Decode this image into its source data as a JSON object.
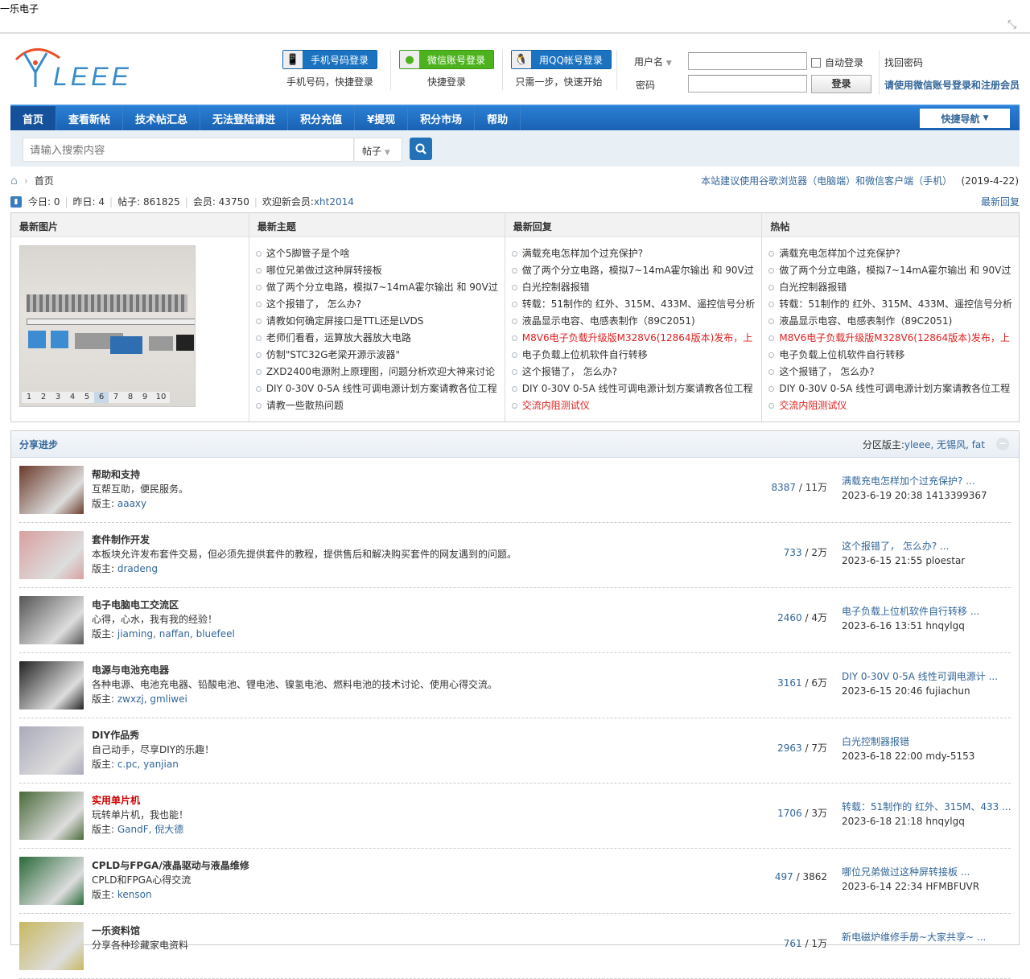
{
  "window": {
    "title": "一乐电子"
  },
  "header": {
    "logo_text": "YLEEE",
    "phone_login": "手机号码登录",
    "phone_sub": "手机号码，快捷登录",
    "wechat_login": "微信账号登录",
    "wechat_sub": "快捷登录",
    "qq_login": "用QQ帐号登录",
    "qq_sub": "只需一步，快速开始",
    "username_label": "用户名",
    "password_label": "密码",
    "username_value": "",
    "password_value": "",
    "auto_login": "自动登录",
    "login_button": "登录",
    "forgot": "找回密码",
    "register_hint": "请使用微信账号登录和注册会员"
  },
  "nav": {
    "items": [
      "首页",
      "查看新帖",
      "技术帖汇总",
      "无法登陆请进",
      "积分充值",
      "¥提现",
      "积分市场",
      "帮助"
    ],
    "quick_nav": "快捷导航"
  },
  "search": {
    "placeholder": "请输入搜索内容",
    "type": "帖子"
  },
  "breadcrumb": {
    "home": "首页",
    "notice": "本站建议使用谷歌浏览器（电脑端）和微信客户端（手机）",
    "date": "(2019-4-22)"
  },
  "stats": {
    "today": "今日: 0",
    "yesterday": "昨日: 4",
    "posts": "帖子: 861825",
    "members": "会员: 43750",
    "welcome": "欢迎新会员: ",
    "new_member": "xht2014",
    "latest_reply": "最新回复"
  },
  "columns": {
    "pics": {
      "title": "最新图片",
      "pages": [
        "1",
        "2",
        "3",
        "4",
        "5",
        "6",
        "7",
        "8",
        "9",
        "10"
      ],
      "active_page": "6"
    },
    "lists": [
      {
        "title": "最新主题",
        "items": [
          {
            "t": "这个5脚管子是个啥"
          },
          {
            "t": "哪位兄弟做过这种屏转接板"
          },
          {
            "t": "做了两个分立电路，模拟7~14mA霍尔输出 和 90V过"
          },
          {
            "t": "这个报错了， 怎么办?"
          },
          {
            "t": "请教如何确定屏接口是TTL还是LVDS"
          },
          {
            "t": "老师们看看，运算放大器放大电路"
          },
          {
            "t": "仿制\"STC32G老梁开源示波器\""
          },
          {
            "t": "ZXD2400电源附上原理图，问题分析欢迎大神来讨论"
          },
          {
            "t": "DIY 0-30V 0-5A 线性可调电源计划方案请教各位工程"
          },
          {
            "t": "请教一些散热问题"
          }
        ]
      },
      {
        "title": "最新回复",
        "items": [
          {
            "t": "满载充电怎样加个过充保护?"
          },
          {
            "t": "做了两个分立电路，模拟7~14mA霍尔输出 和 90V过"
          },
          {
            "t": "白光控制器报错"
          },
          {
            "t": "转载：51制作的 红外、315M、433M、遥控信号分析"
          },
          {
            "t": "液晶显示电容、电感表制作（89C2051)"
          },
          {
            "t": "M8V6电子负载升级版M328V6(12864版本)发布，上",
            "red": true
          },
          {
            "t": "电子负载上位机软件自行转移"
          },
          {
            "t": "这个报错了， 怎么办?"
          },
          {
            "t": "DIY 0-30V 0-5A 线性可调电源计划方案请教各位工程"
          },
          {
            "t": "交流内阻测试仪",
            "red": true
          }
        ]
      },
      {
        "title": "热帖",
        "items": [
          {
            "t": "满载充电怎样加个过充保护?"
          },
          {
            "t": "做了两个分立电路，模拟7~14mA霍尔输出 和 90V过"
          },
          {
            "t": "白光控制器报错"
          },
          {
            "t": "转载：51制作的 红外、315M、433M、遥控信号分析"
          },
          {
            "t": "液晶显示电容、电感表制作（89C2051)"
          },
          {
            "t": "M8V6电子负载升级版M328V6(12864版本)发布，上",
            "red": true
          },
          {
            "t": "电子负载上位机软件自行转移"
          },
          {
            "t": "这个报错了， 怎么办?"
          },
          {
            "t": "DIY 0-30V 0-5A 线性可调电源计划方案请教各位工程"
          },
          {
            "t": "交流内阻测试仪",
            "red": true
          }
        ]
      }
    ]
  },
  "forum": {
    "title": "分享进步",
    "mods_label": "分区版主: ",
    "mods": "yleee, 无锡风, fat",
    "mod_label": "版主: ",
    "rows": [
      {
        "name": "帮助和支持",
        "desc": "互帮互助，便民服务。",
        "mods": "aaaxy",
        "threads": "8387",
        "posts": "11万",
        "last": "满载充电怎样加个过充保护? ...",
        "last_meta": "2023-6-19 20:38 1413399367",
        "color": "#6b3a2a"
      },
      {
        "name": "套件制作开发",
        "desc": "本板块允许发布套件交易，但必须先提供套件的教程，提供售后和解决购买套件的网友遇到的问题。",
        "mods": "dradeng",
        "threads": "733",
        "posts": "2万",
        "last": "这个报错了， 怎么办? ...",
        "last_meta": "2023-6-15 21:55 ploestar",
        "color": "#d9a0a0"
      },
      {
        "name": "电子电脑电工交流区",
        "desc": "心得，心水，我有我的经验！",
        "mods": "jiaming, naffan, bluefeel",
        "threads": "2460",
        "posts": "4万",
        "last": "电子负载上位机软件自行转移 ...",
        "last_meta": "2023-6-16 13:51 hnqylgq",
        "color": "#555"
      },
      {
        "name": "电源与电池充电器",
        "desc": "各种电源、电池充电器、铅酸电池、锂电池、镍氢电池、燃料电池的技术讨论、使用心得交流。",
        "mods": "zwxzj, gmliwei",
        "threads": "3161",
        "posts": "6万",
        "last": "DIY 0-30V 0-5A 线性可调电源计 ...",
        "last_meta": "2023-6-15 20:46 fujiachun",
        "color": "#222"
      },
      {
        "name": "DIY作品秀",
        "desc": "自己动手，尽享DIY的乐趣！",
        "mods": "c.pc, yanjian",
        "threads": "2963",
        "posts": "7万",
        "last": "白光控制器报错",
        "last_meta": "2023-6-18 22:00 mdy-5153",
        "color": "#aab"
      },
      {
        "name": "实用单片机",
        "desc": "玩转单片机，我也能！",
        "mods": "GandF, 倪大德",
        "threads": "1706",
        "posts": "3万",
        "last": "转载：51制作的 红外、315M、433 ...",
        "last_meta": "2023-6-18 21:18 hnqylgq",
        "color": "#4a6a3a",
        "red": true
      },
      {
        "name": "CPLD与FPGA/液晶驱动与液晶维修",
        "desc": "CPLD和FPGA心得交流",
        "mods": "kenson",
        "threads": "497",
        "posts": "3862",
        "last": "哪位兄弟做过这种屏转接板 ...",
        "last_meta": "2023-6-14 22:34 HFMBFUVR",
        "color": "#2a6a3a"
      },
      {
        "name": "一乐资料馆",
        "desc": "分享各种珍藏家电资料",
        "mods": "",
        "threads": "761",
        "posts": "1万",
        "last": "新电磁炉维修手册~大家共享~ ...",
        "last_meta": "",
        "color": "#c8b860"
      }
    ]
  }
}
